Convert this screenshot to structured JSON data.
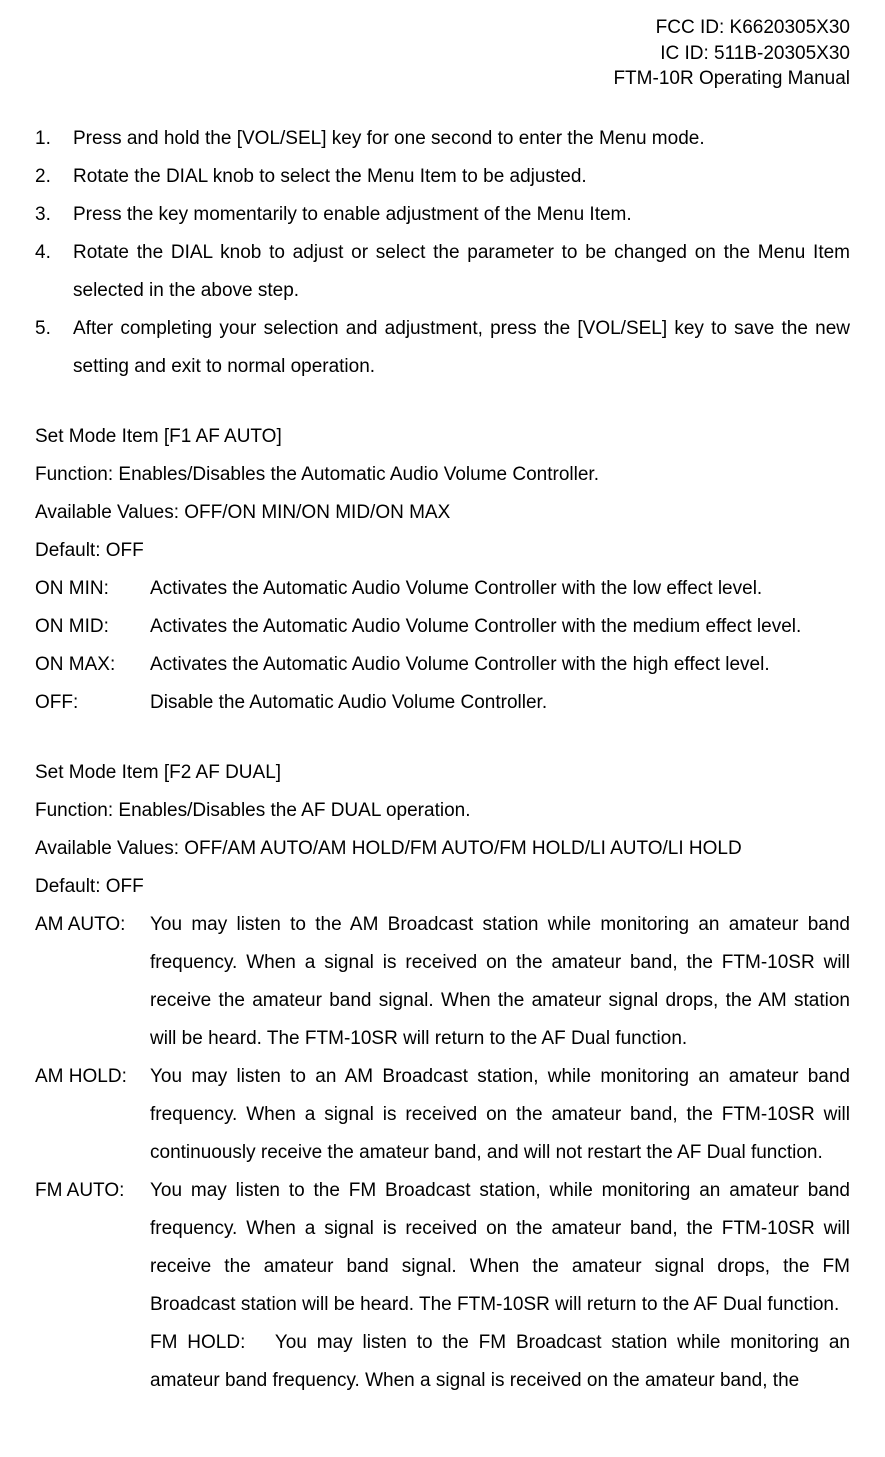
{
  "header": {
    "fcc_id": "FCC ID: K6620305X30",
    "ic_id": "IC ID: 511B-20305X30",
    "manual": "FTM-10R Operating Manual"
  },
  "numbered": {
    "items": [
      {
        "num": "1.",
        "text": "Press and hold the [VOL/SEL] key for one second to enter the Menu mode."
      },
      {
        "num": "2.",
        "text": "Rotate the DIAL knob to select the Menu Item to be adjusted."
      },
      {
        "num": "3.",
        "text": "Press the    key momentarily to enable adjustment of the Menu Item."
      },
      {
        "num": "4.",
        "text": "Rotate the DIAL knob to adjust or select the parameter to be changed on the Menu Item selected in the above step."
      },
      {
        "num": "5.",
        "text": "After completing your selection and adjustment, press the [VOL/SEL] key to save the new setting and exit to normal operation."
      }
    ]
  },
  "f1": {
    "title": "Set Mode Item [F1 AF AUTO]",
    "function": "Function: Enables/Disables the Automatic Audio Volume Controller.",
    "available": "Available Values: OFF/ON MIN/ON MID/ON MAX",
    "default": "Default: OFF",
    "defs": [
      {
        "label": "ON MIN:",
        "text": "Activates the Automatic Audio Volume Controller with the low effect level."
      },
      {
        "label": "ON MID:",
        "text": "Activates the Automatic Audio Volume Controller with the medium effect level."
      },
      {
        "label": "ON MAX:",
        "text": "Activates the Automatic Audio Volume Controller with the high effect level."
      },
      {
        "label": "OFF:",
        "text": "Disable the Automatic Audio Volume Controller."
      }
    ]
  },
  "f2": {
    "title": "Set Mode Item [F2 AF DUAL]",
    "function": "Function: Enables/Disables the AF DUAL operation.",
    "available": "Available Values: OFF/AM AUTO/AM HOLD/FM AUTO/FM HOLD/LI AUTO/LI HOLD",
    "default": "Default: OFF",
    "defs": [
      {
        "label": "AM AUTO:",
        "text": "You may listen to the AM Broadcast station while monitoring an amateur band frequency. When a signal is received on the amateur band, the FTM-10SR will receive the amateur band signal. When the amateur signal drops, the AM station will be heard.  The FTM-10SR will return to the AF Dual function."
      },
      {
        "label": "AM HOLD:",
        "text": "You may listen to an AM Broadcast station, while monitoring an amateur band frequency. When a signal is received on the amateur band, the FTM-10SR will continuously receive the amateur band, and will not restart the AF Dual function."
      },
      {
        "label": "FM AUTO:",
        "text": "You may listen to the FM Broadcast station, while monitoring an amateur band frequency. When a signal is received on the amateur band, the FTM-10SR will receive the amateur band signal. When the amateur signal drops, the FM Broadcast station will be heard.  The FTM-10SR will return to the AF Dual function."
      }
    ],
    "fm_hold_label": "FM HOLD:",
    "fm_hold_text": "You may listen to the FM Broadcast station while monitoring an amateur band frequency. When a signal is received on the amateur band, the"
  }
}
